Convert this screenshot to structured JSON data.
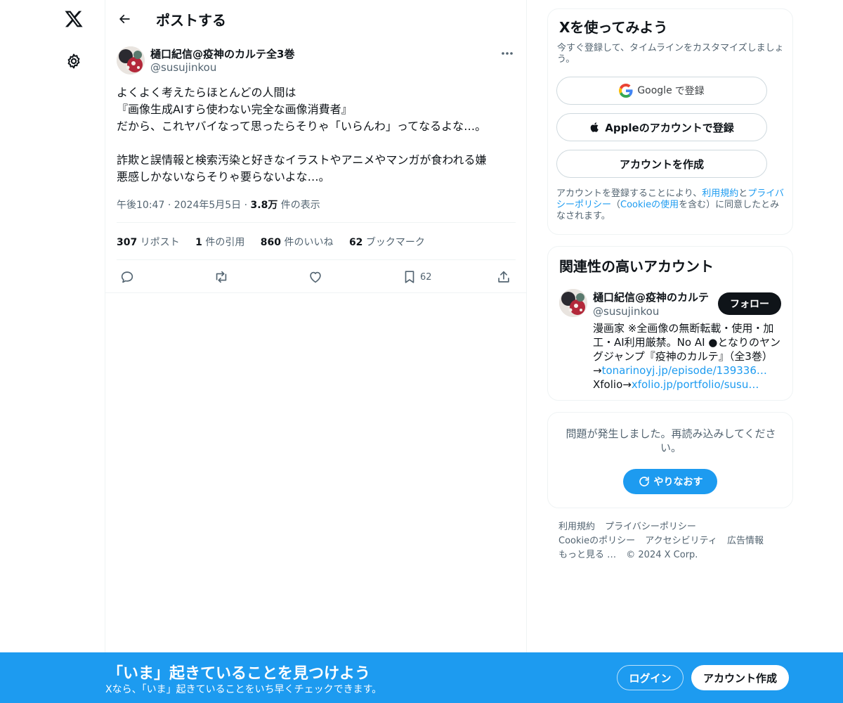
{
  "colors": {
    "accent": "#1d9bf0",
    "text": "#0f1419",
    "muted": "#536471",
    "border": "#eff3f4"
  },
  "nav": {
    "logo_icon": "x-logo-icon",
    "settings_icon": "gear-icon"
  },
  "header": {
    "title": "ポストする",
    "back_icon": "arrow-left-icon"
  },
  "post": {
    "author_name": "樋口紀信@疫神のカルテ全3巻",
    "author_handle": "@susujinkou",
    "text_lines": [
      "よくよく考えたらほとんどの人間は",
      "『画像生成AIすら使わない完全な画像消費者』",
      "だから、これヤバイなって思ったらそりゃ「いらんわ」ってなるよな…。",
      "",
      "詐欺と誤情報と検索汚染と好きなイラストやアニメやマンガが食われる嫌",
      "悪感しかないならそりゃ要らないよな…。"
    ],
    "time": "午後10:47",
    "date": "2024年5月5日",
    "views_count": "3.8万",
    "views_label": "件の表示",
    "stats": {
      "reposts_count": "307",
      "reposts_label": "リポスト",
      "quotes_count": "1",
      "quotes_label": "件の引用",
      "likes_count": "860",
      "likes_label": "件のいいね",
      "bookmarks_count": "62",
      "bookmarks_label": "ブックマーク"
    },
    "bookmark_action_count": "62"
  },
  "signup_card": {
    "title": "Xを使ってみよう",
    "subtitle": "今すぐ登録して、タイムラインをカスタマイズしましょう。",
    "google_brand": "Google",
    "google_suffix": "で登録",
    "apple_label": "Appleのアカウントで登録",
    "create_label": "アカウントを作成",
    "legal_1": "アカウントを登録することにより、",
    "legal_terms": "利用規約",
    "legal_2": "と",
    "legal_privacy": "プライバシーポリシー",
    "legal_3": "（",
    "legal_cookie": "Cookieの使用",
    "legal_4": "を含む）に同意したとみなされます。"
  },
  "related": {
    "title": "関連性の高いアカウント",
    "name": "樋口紀信@疫神のカルテ",
    "handle": "@susujinkou",
    "follow_label": "フォロー",
    "bio_line1": "漫画家 ※全画像の無断転載・使用・加",
    "bio_line2": "工・AI利用厳禁。No AI ●となりのヤン",
    "bio_line3": "グジャンプ『疫神のカルテ』（全3巻）",
    "bio_arrow": "→",
    "bio_link1": "tonarinoyj.jp/episode/139336…",
    "bio_xfolio": "Xfolio→",
    "bio_link2": "xfolio.jp/portfolio/susu…"
  },
  "error_card": {
    "message": "問題が発生しました。再読み込みしてください。",
    "retry_label": "やりなおす"
  },
  "footer": {
    "terms": "利用規約",
    "privacy": "プライバシーポリシー",
    "cookie": "Cookieのポリシー",
    "accessibility": "アクセシビリティ",
    "ads": "広告情報",
    "more": "もっと見る …",
    "copyright": "© 2024 X Corp."
  },
  "banner": {
    "title": "「いま」起きていることを見つけよう",
    "subtitle": "Xなら、「いま」起きていることをいち早くチェックできます。",
    "login_label": "ログイン",
    "signup_label": "アカウント作成"
  }
}
